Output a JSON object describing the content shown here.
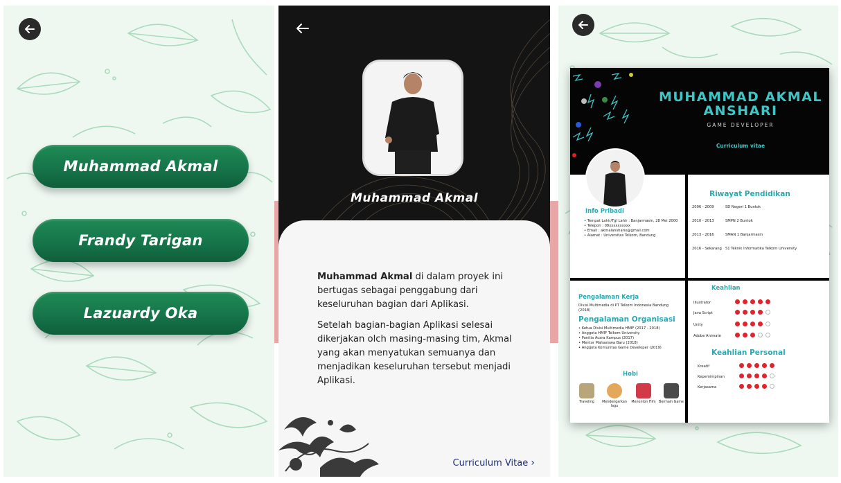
{
  "panel1": {
    "back_icon": "arrow-left-icon",
    "names": [
      "Muhammad Akmal",
      "Frandy Tarigan",
      "Lazuardy Oka"
    ]
  },
  "panel2": {
    "back_icon": "arrow-left-icon",
    "name": "Muhammad Akmal",
    "paragraph1_bold": "Muhammad Akmal",
    "paragraph1_rest": " di dalam proyek ini bertugas sebagai penggabung dari keseluruhan bagian dari Aplikasi.",
    "paragraph2": "Setelah bagian-bagian Aplikasi selesai dikerjakan olch masing-masing tim, Akmal yang akan menyatukan semuanya dan menjadikan keseluruhan tersebut menjadi Aplikasi.",
    "cv_link": "Curriculum Vitae",
    "cv_link_icon": "chevron-right-icon"
  },
  "panel3": {
    "back_icon": "arrow-left-icon",
    "name_line1": "MUHAMMAD AKMAL",
    "name_line2": "ANSHARI",
    "role": "GAME DEVELOPER",
    "subtitle": "Curriculum vitae",
    "info_title": "Info Pribadi",
    "info_items": [
      "• Tempat Lahir/Tgl Lahir : Banjarmasin, 28 Mei 2000",
      "• Telepon : 08xxxxxxxxxx",
      "• Email : akmalansharix@gmail.com",
      "• Alamat : Universitas Telkom, Bandung"
    ],
    "edu_title": "Riwayat Pendidikan",
    "edu": [
      {
        "year": "2006 - 2009",
        "school": "SD Negeri 1 Buntok"
      },
      {
        "year": "2010 - 2013",
        "school": "SMPN 2 Buntok"
      },
      {
        "year": "2013 - 2016",
        "school": "SMAN 1 Banjarmasin"
      },
      {
        "year": "2016 - Sekarang",
        "school": "S1 Teknik Informatika Telkom University"
      }
    ],
    "work_title": "Pengalaman Kerja",
    "work_text": "Divisi Multimedia di PT Telkom Indonesia Bandung (2018)",
    "org_title": "Pengalaman Organisasi",
    "org_items": [
      "• Ketua Divisi Multimedia HMIF (2017 - 2018)",
      "• Anggota HMIF Telkom University",
      "• Panitia Acara Kampus (2017)",
      "• Mentor Mahasiswa Baru (2018)",
      "• Anggota Komunitas Game Developer (2019)"
    ],
    "hobi_title": "Hobi",
    "hobbies": [
      "Traveling",
      "Mendengarkan lagu",
      "Menonton Film",
      "Bermain Game"
    ],
    "skill_title": "Keahlian",
    "skills": [
      {
        "name": "Illustrator",
        "level": 5
      },
      {
        "name": "Java Script",
        "level": 4
      },
      {
        "name": "Unity",
        "level": 4
      },
      {
        "name": "Adobe Animate",
        "level": 3
      }
    ],
    "personal_title": "Keahlian Personal",
    "personal": [
      {
        "name": "Kreatif",
        "level": 5
      },
      {
        "name": "Kepemimpinan",
        "level": 4
      },
      {
        "name": "Kerjasama",
        "level": 4
      }
    ]
  }
}
